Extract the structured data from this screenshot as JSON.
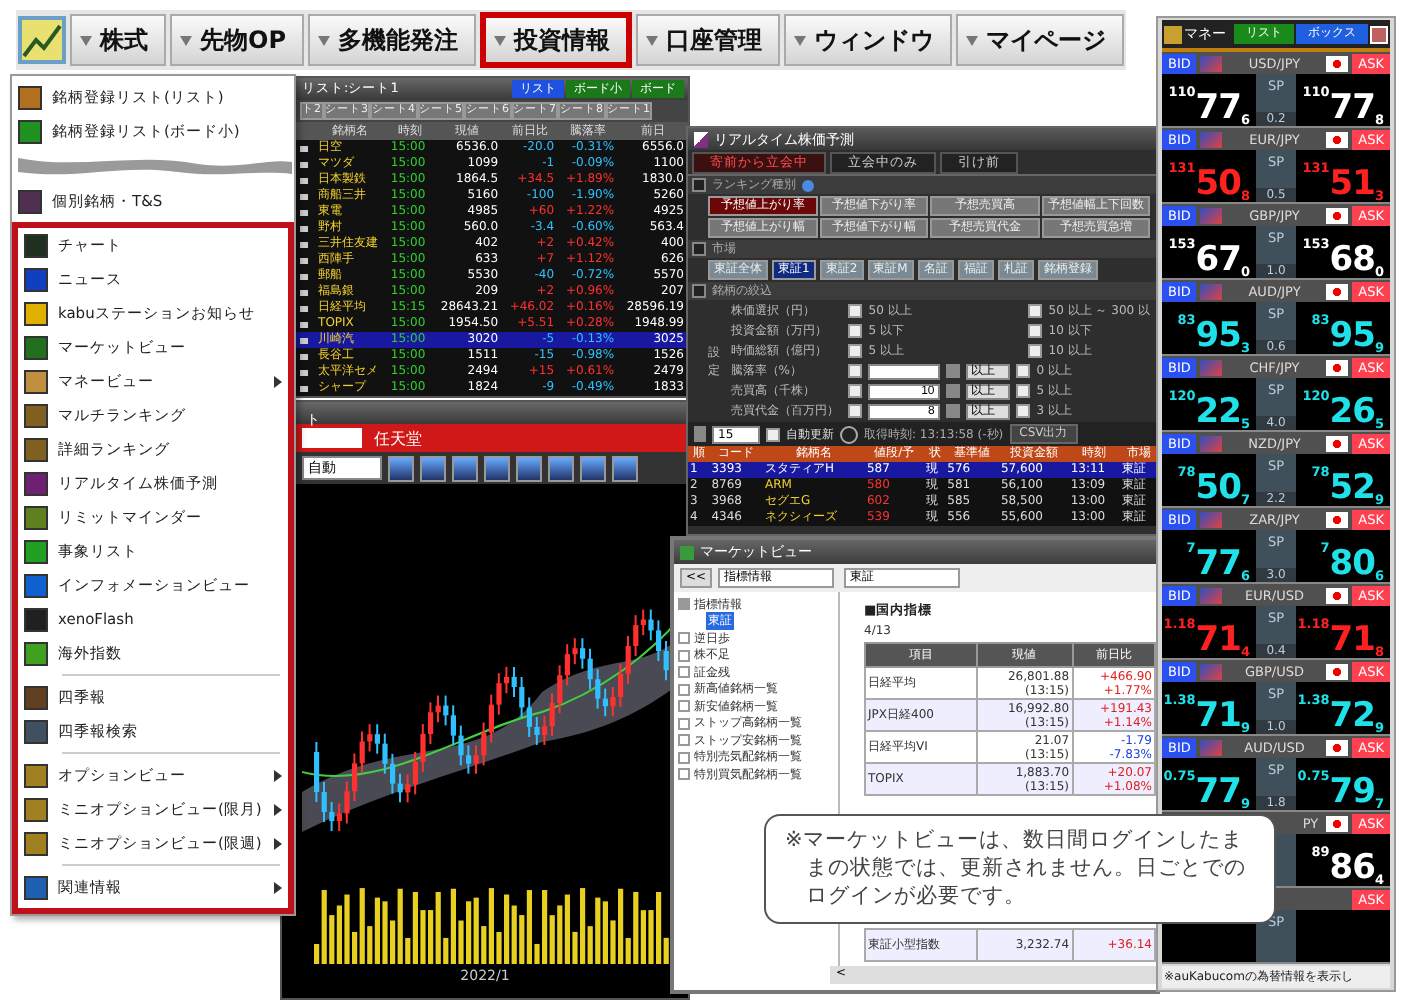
{
  "menubar": {
    "items": [
      {
        "label": "株式",
        "selected": false
      },
      {
        "label": "先物OP",
        "selected": false
      },
      {
        "label": "多機能発注",
        "selected": false
      },
      {
        "label": "投資情報",
        "selected": true
      },
      {
        "label": "口座管理",
        "selected": false
      },
      {
        "label": "ウィンドウ",
        "selected": false
      },
      {
        "label": "マイページ",
        "selected": false
      }
    ]
  },
  "menu": {
    "top_items": [
      {
        "kind": "item",
        "label": "銘柄登録リスト(リスト)",
        "submenu": false
      },
      {
        "kind": "item",
        "label": "銘柄登録リスト(ボード小)",
        "submenu": false
      },
      {
        "kind": "break"
      },
      {
        "kind": "item",
        "label": "個別銘柄・T&S",
        "submenu": false
      }
    ],
    "framed_items": [
      {
        "kind": "item",
        "label": "チャート",
        "submenu": false
      },
      {
        "kind": "item",
        "label": "ニュース",
        "submenu": false
      },
      {
        "kind": "item",
        "label": "kabuステーションお知らせ",
        "submenu": false
      },
      {
        "kind": "item",
        "label": "マーケットビュー",
        "submenu": false
      },
      {
        "kind": "item",
        "label": "マネービュー",
        "submenu": true
      },
      {
        "kind": "item",
        "label": "マルチランキング",
        "submenu": false
      },
      {
        "kind": "item",
        "label": "詳細ランキング",
        "submenu": false
      },
      {
        "kind": "item",
        "label": "リアルタイム株価予測",
        "submenu": false
      },
      {
        "kind": "item",
        "label": "リミットマインダー",
        "submenu": false
      },
      {
        "kind": "item",
        "label": "事象リスト",
        "submenu": false
      },
      {
        "kind": "item",
        "label": "インフォメーションビュー",
        "submenu": false
      },
      {
        "kind": "item",
        "label": "xenoFlash",
        "submenu": false
      },
      {
        "kind": "item",
        "label": "海外指数",
        "submenu": false
      },
      {
        "kind": "separator"
      },
      {
        "kind": "item",
        "label": "四季報",
        "submenu": false
      },
      {
        "kind": "item",
        "label": "四季報検索",
        "submenu": false
      },
      {
        "kind": "separator"
      },
      {
        "kind": "item",
        "label": "オプションビュー",
        "submenu": true
      },
      {
        "kind": "item",
        "label": "ミニオプションビュー(限月)",
        "submenu": true
      },
      {
        "kind": "item",
        "label": "ミニオプションビュー(限週)",
        "submenu": true
      },
      {
        "kind": "separator"
      },
      {
        "kind": "item",
        "label": "関連情報",
        "submenu": true
      }
    ]
  },
  "stock_list": {
    "title": "リスト:シート1",
    "view_tabs": [
      {
        "label": "リスト",
        "selected": true
      },
      {
        "label": "ボード小",
        "selected": false
      },
      {
        "label": "ボード",
        "selected": false
      }
    ],
    "sheets": [
      "ト2",
      "シート3",
      "シート4",
      "シート5",
      "シート6",
      "シート7",
      "シート8",
      "シート1"
    ],
    "columns": [
      "銘柄名",
      "時刻",
      "現値",
      "前日比",
      "騰落率",
      "前日"
    ],
    "rows": [
      {
        "cells": [
          "日空",
          "15:00",
          "6536.0",
          "-20.0",
          "-0.31%",
          "6556.0"
        ],
        "selected": false
      },
      {
        "cells": [
          "マツダ",
          "15:00",
          "1099",
          "-1",
          "-0.09%",
          "1100"
        ],
        "selected": false
      },
      {
        "cells": [
          "日本製鉄",
          "15:00",
          "1864.5",
          "+34.5",
          "+1.89%",
          "1830.0"
        ],
        "selected": false
      },
      {
        "cells": [
          "商船三井",
          "15:00",
          "5160",
          "-100",
          "-1.90%",
          "5260"
        ],
        "selected": false
      },
      {
        "cells": [
          "東電",
          "15:00",
          "4985",
          "+60",
          "+1.22%",
          "4925"
        ],
        "selected": false
      },
      {
        "cells": [
          "野村",
          "15:00",
          "560.0",
          "-3.4",
          "-0.60%",
          "563.4"
        ],
        "selected": false
      },
      {
        "cells": [
          "三井住友建",
          "15:00",
          "402",
          "+2",
          "+0.42%",
          "400"
        ],
        "selected": false
      },
      {
        "cells": [
          "西陣手",
          "15:00",
          "633",
          "+7",
          "+1.12%",
          "626"
        ],
        "selected": false
      },
      {
        "cells": [
          "郵船",
          "15:00",
          "5530",
          "-40",
          "-0.72%",
          "5570"
        ],
        "selected": false
      },
      {
        "cells": [
          "福島銀",
          "15:00",
          "209",
          "+2",
          "+0.96%",
          "207"
        ],
        "selected": false
      },
      {
        "cells": [
          "日経平均",
          "15:15",
          "28643.21",
          "+46.02",
          "+0.16%",
          "28596.19"
        ],
        "selected": false
      },
      {
        "cells": [
          "TOPIX",
          "15:00",
          "1954.50",
          "+5.51",
          "+0.28%",
          "1948.99"
        ],
        "selected": false
      },
      {
        "cells": [
          "川崎汽",
          "15:00",
          "3020",
          "-5",
          "-0.13%",
          "3025"
        ],
        "selected": true
      },
      {
        "cells": [
          "長谷工",
          "15:00",
          "1511",
          "-15",
          "-0.98%",
          "1526"
        ],
        "selected": false
      },
      {
        "cells": [
          "太平洋セメ",
          "15:00",
          "2494",
          "+15",
          "+0.61%",
          "2479"
        ],
        "selected": false
      },
      {
        "cells": [
          "シャープ",
          "15:00",
          "1824",
          "-9",
          "-0.49%",
          "1833"
        ],
        "selected": false
      }
    ]
  },
  "chart_window": {
    "title": "ト",
    "symbol": "任天堂",
    "period": "自動",
    "x_label": "2022/1"
  },
  "realtime": {
    "title": "リアルタイム株価予測",
    "tabs": [
      {
        "label": "寄前から立会中",
        "selected": true
      },
      {
        "label": "立会中のみ",
        "selected": false
      },
      {
        "label": "引け前",
        "selected": false
      }
    ],
    "ranking_heading": "ランキング種別",
    "ranking_buttons": [
      {
        "label": "予想値上がり率",
        "selected": true
      },
      {
        "label": "予想値下がり率",
        "selected": false
      },
      {
        "label": "予想売買高",
        "selected": false
      },
      {
        "label": "予想値幅上下回数",
        "selected": false
      },
      {
        "label": "予想値上がり幅",
        "selected": false
      },
      {
        "label": "予想値下がり幅",
        "selected": false
      },
      {
        "label": "予想売買代金",
        "selected": false
      },
      {
        "label": "予想売買急増",
        "selected": false
      }
    ],
    "market_heading": "市場",
    "market_buttons": [
      {
        "label": "東証全体",
        "selected": false
      },
      {
        "label": "東証1",
        "selected": true
      },
      {
        "label": "東証2",
        "selected": false
      },
      {
        "label": "東証M",
        "selected": false
      },
      {
        "label": "名証",
        "selected": false
      },
      {
        "label": "福証",
        "selected": false
      },
      {
        "label": "札証",
        "selected": false
      },
      {
        "label": "銘柄登録",
        "selected": false
      }
    ],
    "filter_heading": "銘柄の絞込",
    "filter_side_label": "設定",
    "filters": [
      {
        "kind": "check",
        "label": "株価選択（円）",
        "checked": false,
        "value": "50 以上",
        "right_checked": false,
        "right": "50 以上 ～ 300 以"
      },
      {
        "kind": "check",
        "label": "投資金額（万円）",
        "checked": false,
        "value": "5 以下",
        "right_checked": false,
        "right": "10 以下"
      },
      {
        "kind": "check",
        "label": "時価総額（億円）",
        "checked": false,
        "value": "5 以上",
        "right_checked": false,
        "right": "10 以上"
      },
      {
        "kind": "input",
        "label": "騰落率（%）",
        "checked": false,
        "unit": "以上",
        "right_checked": false,
        "right": "0 以上"
      },
      {
        "kind": "input",
        "label": "売買高（千株）",
        "checked": false,
        "value": "10",
        "unit": "以上",
        "right_checked": false,
        "right": "5 以上"
      },
      {
        "kind": "input",
        "label": "売買代金（百万円）",
        "checked": false,
        "value": "8",
        "unit": "以上",
        "right_checked": false,
        "right": "3 以上"
      }
    ],
    "count": "15",
    "auto_update": {
      "label": "自動更新",
      "checked": false
    },
    "fetch_time": "取得時刻: 13:13:58 (-秒)",
    "csv_button": "CSV出力",
    "columns": [
      "順",
      "コード",
      "銘柄名",
      "値段/予",
      "状",
      "基準値",
      "投資金額",
      "時刻",
      "市場"
    ],
    "rows": [
      {
        "cells": [
          "1",
          "3393",
          "スタティアH",
          "587",
          "現",
          "576",
          "57,600",
          "13:11",
          "東証"
        ],
        "selected": true
      },
      {
        "cells": [
          "2",
          "8769",
          "ARM",
          "580",
          "現",
          "581",
          "56,100",
          "13:09",
          "東証"
        ],
        "selected": false
      },
      {
        "cells": [
          "3",
          "3968",
          "セグエG",
          "602",
          "現",
          "585",
          "58,500",
          "13:00",
          "東証"
        ],
        "selected": false
      },
      {
        "cells": [
          "4",
          "4346",
          "ネクシィーズ",
          "539",
          "現",
          "556",
          "55,600",
          "13:00",
          "東証"
        ],
        "selected": false
      }
    ]
  },
  "market_view": {
    "title": "マーケットビュー",
    "back": "<<",
    "category": "指標情報",
    "exchange": "東証",
    "tree": [
      {
        "label": "指標情報",
        "expanded": true,
        "children": [
          {
            "label": "東証",
            "selected": true
          }
        ]
      },
      {
        "label": "逆日歩",
        "expanded": false
      },
      {
        "label": "株不足",
        "expanded": false
      },
      {
        "label": "証金残",
        "expanded": false
      },
      {
        "label": "新高値銘柄一覧",
        "expanded": false
      },
      {
        "label": "新安値銘柄一覧",
        "expanded": false
      },
      {
        "label": "ストップ高銘柄一覧",
        "expanded": false
      },
      {
        "label": "ストップ安銘柄一覧",
        "expanded": false
      },
      {
        "label": "特別売気配銘柄一覧",
        "expanded": false
      },
      {
        "label": "特別買気配銘柄一覧",
        "expanded": false
      }
    ],
    "heading": "■国内指標",
    "date": "4/13",
    "columns": [
      "項目",
      "現値",
      "前日比"
    ],
    "rows": [
      {
        "name": "日経平均",
        "value": "26,801.88",
        "time": "(13:15)",
        "change": "+466.90",
        "pct": "+1.77%",
        "color": "#e02020"
      },
      {
        "name": "JPX日経400",
        "value": "16,992.80",
        "time": "(13:15)",
        "change": "+191.43",
        "pct": "+1.14%",
        "color": "#e02020"
      },
      {
        "name": "日経平均VI",
        "value": "21.07",
        "time": "(13:15)",
        "change": "-1.79",
        "pct": "-7.83%",
        "color": "#2040e0"
      },
      {
        "name": "TOPIX",
        "value": "1,883.70",
        "time": "(13:15)",
        "change": "+20.07",
        "pct": "+1.08%",
        "color": "#e02020"
      }
    ],
    "last_row": {
      "name": "東証小型指数",
      "value": "3,232.74",
      "change": "+36.14",
      "color": "#e02020"
    },
    "scroll_left": "<"
  },
  "money_view": {
    "title": "マネー",
    "tabs": [
      {
        "label": "リスト",
        "selected": false
      },
      {
        "label": "ボックス",
        "selected": true
      }
    ],
    "pairs": [
      {
        "bid_label": "BID",
        "pair": "USD/JPY",
        "ask_label": "ASK",
        "sp_label": "SP",
        "bid": [
          "110",
          "77",
          "6"
        ],
        "ask": [
          "110",
          "77",
          "8"
        ],
        "sp": "0.2",
        "color": "#ffffff"
      },
      {
        "bid_label": "BID",
        "pair": "EUR/JPY",
        "ask_label": "ASK",
        "sp_label": "SP",
        "bid": [
          "131",
          "50",
          "8"
        ],
        "ask": [
          "131",
          "51",
          "3"
        ],
        "sp": "0.5",
        "color": "#ff2020"
      },
      {
        "bid_label": "BID",
        "pair": "GBP/JPY",
        "ask_label": "ASK",
        "sp_label": "SP",
        "bid": [
          "153",
          "67",
          "0"
        ],
        "ask": [
          "153",
          "68",
          "0"
        ],
        "sp": "1.0",
        "color": "#ffffff"
      },
      {
        "bid_label": "BID",
        "pair": "AUD/JPY",
        "ask_label": "ASK",
        "sp_label": "SP",
        "bid": [
          "83",
          "95",
          "3"
        ],
        "ask": [
          "83",
          "95",
          "9"
        ],
        "sp": "0.6",
        "color": "#20e0e8"
      },
      {
        "bid_label": "BID",
        "pair": "CHF/JPY",
        "ask_label": "ASK",
        "sp_label": "SP",
        "bid": [
          "120",
          "22",
          "5"
        ],
        "ask": [
          "120",
          "26",
          "5"
        ],
        "sp": "4.0",
        "color": "#20e0e8"
      },
      {
        "bid_label": "BID",
        "pair": "NZD/JPY",
        "ask_label": "ASK",
        "sp_label": "SP",
        "bid": [
          "78",
          "50",
          "7"
        ],
        "ask": [
          "78",
          "52",
          "9"
        ],
        "sp": "2.2",
        "color": "#20e0e8"
      },
      {
        "bid_label": "BID",
        "pair": "ZAR/JPY",
        "ask_label": "ASK",
        "sp_label": "SP",
        "bid": [
          "7",
          "77",
          "6"
        ],
        "ask": [
          "7",
          "80",
          "6"
        ],
        "sp": "3.0",
        "color": "#20e0e8"
      },
      {
        "bid_label": "BID",
        "pair": "EUR/USD",
        "ask_label": "ASK",
        "sp_label": "SP",
        "bid": [
          "1.18",
          "71",
          "4"
        ],
        "ask": [
          "1.18",
          "71",
          "8"
        ],
        "sp": "0.4",
        "color": "#ff2020"
      },
      {
        "bid_label": "BID",
        "pair": "GBP/USD",
        "ask_label": "ASK",
        "sp_label": "SP",
        "bid": [
          "1.38",
          "71",
          "9"
        ],
        "ask": [
          "1.38",
          "72",
          "9"
        ],
        "sp": "1.0",
        "color": "#20e0e8"
      },
      {
        "bid_label": "BID",
        "pair": "AUD/USD",
        "ask_label": "ASK",
        "sp_label": "SP",
        "bid": [
          "0.75",
          "77",
          "9"
        ],
        "ask": [
          "0.75",
          "79",
          "7"
        ],
        "sp": "1.8",
        "color": "#20e0e8"
      },
      {
        "pair": "PY",
        "ask_label": "ASK",
        "ask": [
          "89",
          "86",
          "4"
        ],
        "color": "#ffffff"
      },
      {
        "ask_label": "ASK",
        "sp_label": "SP"
      }
    ],
    "note": "※auKabucomの為替情報を表示し"
  },
  "callout": "※マーケットビューは、数日間ログインしたままの状態では、更新されません。日ごとでのログインが必要です。"
}
